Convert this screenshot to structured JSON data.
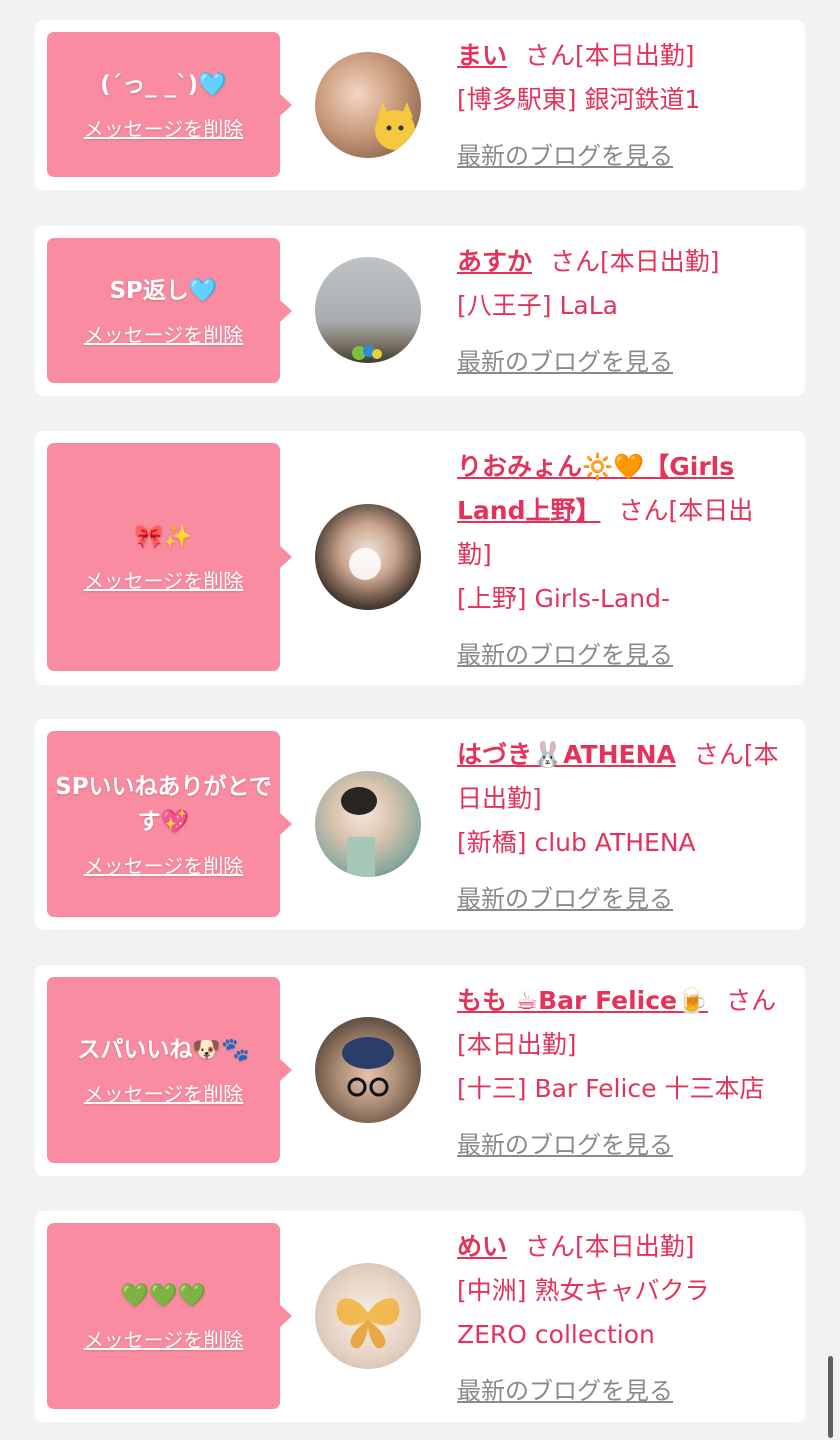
{
  "delete_label": "メッセージを削除",
  "blog_label": "最新のブログを見る",
  "items": [
    {
      "message": "(´っ_ _`)🩵",
      "name": "まい",
      "san": "さん[本日出勤]",
      "location": "[博多駅東] 銀河鉄道1"
    },
    {
      "message": "SP返し🩵",
      "name": "あすか",
      "san": "さん[本日出勤]",
      "location": "[八王子] LaLa"
    },
    {
      "message": "🎀✨",
      "name": "りおみょん🔆🧡【Girls Land上野】",
      "san": "さん[本日出勤]",
      "location": "[上野] Girls-Land-"
    },
    {
      "message": "SPいいねありがとです💖",
      "name": "はづき🐰ATHENA",
      "san": "さん[本日出勤]",
      "location": "[新橋] club ATHENA"
    },
    {
      "message": "スパいいね🐶🐾",
      "name": "もも ☕Bar Felice🍺",
      "san": "さん[本日出勤]",
      "location": "[十三] Bar Felice 十三本店"
    },
    {
      "message": "💚💚💚",
      "name": "めい",
      "san": "さん[本日出勤]",
      "location": "[中洲] 熟女キャバクラ ZERO collection"
    }
  ]
}
